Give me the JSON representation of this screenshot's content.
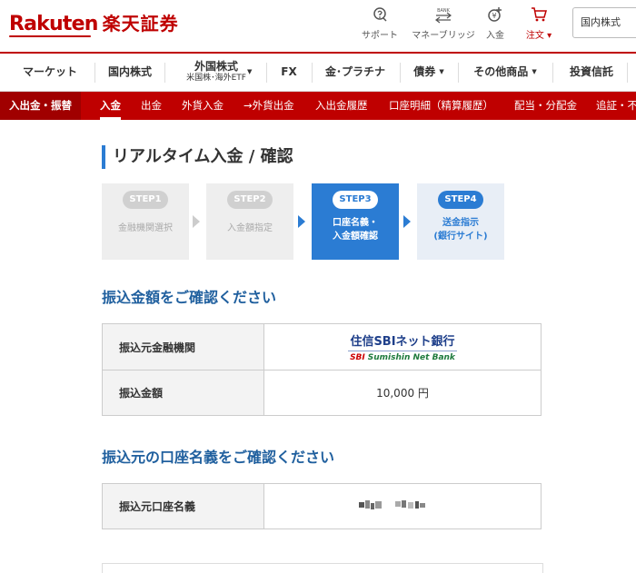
{
  "header": {
    "logo_en": "Rakuten",
    "logo_jp": "楽天証券",
    "icons": [
      {
        "name": "support-icon",
        "label": "サポート"
      },
      {
        "name": "money-bridge-icon",
        "label": "マネーブリッジ"
      },
      {
        "name": "deposit-icon",
        "label": "入金"
      },
      {
        "name": "order-cart-icon",
        "label": "注文 ▾"
      }
    ],
    "search_placeholder": "国内株式"
  },
  "nav1": {
    "items": [
      {
        "label": "マーケット"
      },
      {
        "label": "国内株式"
      },
      {
        "label": "外国株式",
        "sub": "米国株･海外ETF"
      },
      {
        "label": "FX"
      },
      {
        "label": "金･プラチナ"
      },
      {
        "label": "債券"
      },
      {
        "label": "その他商品"
      },
      {
        "label": "投資信託"
      }
    ]
  },
  "nav2": {
    "head": "入出金・振替",
    "items": [
      "入金",
      "出金",
      "外貨入金",
      "→外貨出金",
      "入出金履歴",
      "口座明細（精算履歴）",
      "配当・分配金",
      "追証・不"
    ]
  },
  "page": {
    "title": "リアルタイム入金 / 確認"
  },
  "steps": [
    {
      "badge": "STEP1",
      "text1": "金融機関選択",
      "text2": ""
    },
    {
      "badge": "STEP2",
      "text1": "入金額指定",
      "text2": ""
    },
    {
      "badge": "STEP3",
      "text1": "口座名義・",
      "text2": "入金額確認"
    },
    {
      "badge": "STEP4",
      "text1": "送金指示",
      "text2": "(銀行サイト)"
    }
  ],
  "section1": {
    "title": "振込金額をご確認ください",
    "rows": [
      {
        "label": "振込元金融機関",
        "bank_jp": "住信SBIネット銀行",
        "bank_en_sbi": "SBI",
        "bank_en_rest": "Sumishin Net Bank"
      },
      {
        "label": "振込金額",
        "value": "10,000 円"
      }
    ]
  },
  "section2": {
    "title": "振込元の口座名義をご確認ください",
    "rows": [
      {
        "label": "振込元口座名義"
      }
    ]
  },
  "colors": {
    "brand_red": "#bf0000",
    "accent_blue": "#2b7cd3",
    "section_title": "#1f5f9e"
  }
}
